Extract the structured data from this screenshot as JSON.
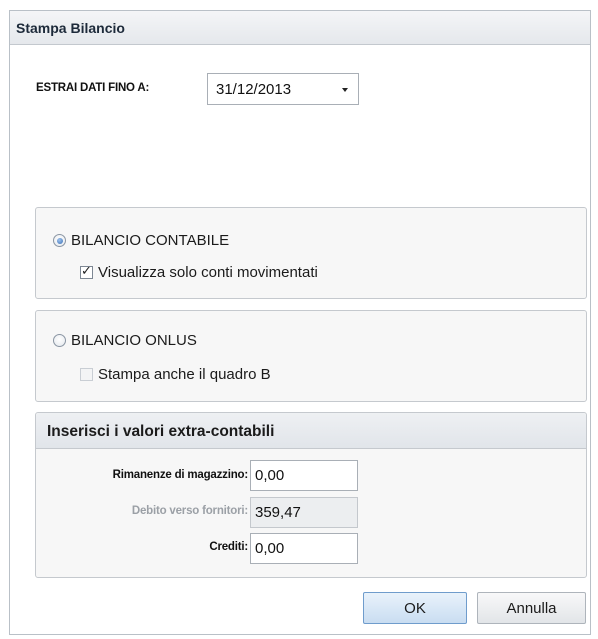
{
  "dialog": {
    "title": "Stampa Bilancio"
  },
  "extract": {
    "label": "ESTRAI DATI FINO A:",
    "date_value": "31/12/2013",
    "dropdown_icon": "chevron-down-icon"
  },
  "bilancio_contabile": {
    "radio_label": "BILANCIO CONTABILE",
    "selected": true,
    "checkbox_label": "Visualizza solo conti movimentati",
    "checked": true
  },
  "bilancio_onlus": {
    "radio_label": "BILANCIO ONLUS",
    "selected": false,
    "checkbox_label": "Stampa anche il quadro B",
    "checked": false
  },
  "extra": {
    "title": "Inserisci i valori extra-contabili",
    "fields": [
      {
        "label": "Rimanenze di magazzino:",
        "value": "0,00",
        "enabled": true
      },
      {
        "label": "Debito verso fornitori:",
        "value": "359,47",
        "enabled": false
      },
      {
        "label": "Crediti:",
        "value": "0,00",
        "enabled": true
      }
    ]
  },
  "buttons": {
    "ok": "OK",
    "cancel": "Annulla"
  },
  "colors": {
    "accent": "#3a6fb4",
    "ok_border": "#6f9ccc"
  }
}
